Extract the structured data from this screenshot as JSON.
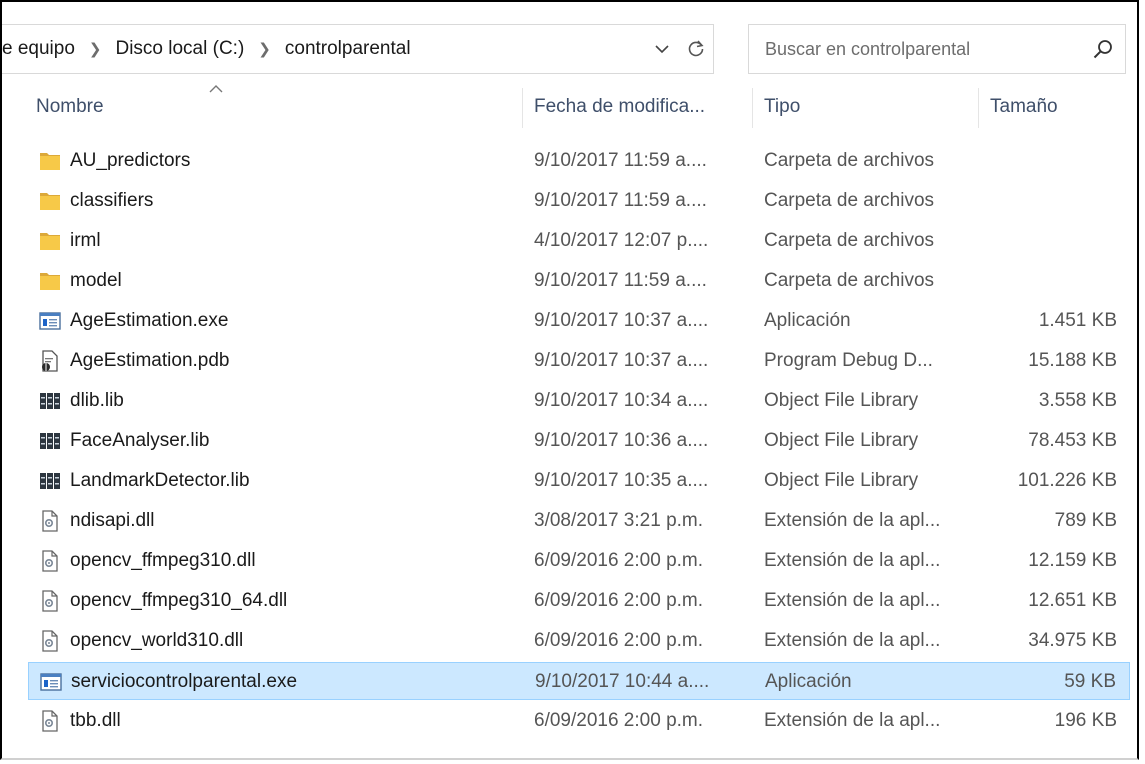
{
  "address": {
    "crumbs": [
      "e equipo",
      "Disco local (C:)",
      "controlparental"
    ],
    "chevron_icon": "chevron-right-icon",
    "dropdown_icon": "chevron-down-icon",
    "refresh_icon": "refresh-icon"
  },
  "search": {
    "placeholder": "Buscar en controlparental",
    "icon": "search-icon"
  },
  "columns": {
    "name": "Nombre",
    "date": "Fecha de modifica...",
    "type": "Tipo",
    "size": "Tamaño",
    "sorted_by": "name"
  },
  "colors": {
    "folder": "#f7c948",
    "selection_bg": "#cce8ff",
    "selection_border": "#99d1ff",
    "header_text": "#3f4f6a"
  },
  "files": [
    {
      "name": "AU_predictors",
      "date": "9/10/2017 11:59 a....",
      "type": "Carpeta de archivos",
      "size": "",
      "icon": "folder-icon"
    },
    {
      "name": "classifiers",
      "date": "9/10/2017 11:59 a....",
      "type": "Carpeta de archivos",
      "size": "",
      "icon": "folder-icon"
    },
    {
      "name": "irml",
      "date": "4/10/2017 12:07 p....",
      "type": "Carpeta de archivos",
      "size": "",
      "icon": "folder-icon"
    },
    {
      "name": "model",
      "date": "9/10/2017 11:59 a....",
      "type": "Carpeta de archivos",
      "size": "",
      "icon": "folder-icon"
    },
    {
      "name": "AgeEstimation.exe",
      "date": "9/10/2017 10:37 a....",
      "type": "Aplicación",
      "size": "1.451 KB",
      "icon": "application-icon"
    },
    {
      "name": "AgeEstimation.pdb",
      "date": "9/10/2017 10:37 a....",
      "type": "Program Debug D...",
      "size": "15.188 KB",
      "icon": "debug-file-icon"
    },
    {
      "name": "dlib.lib",
      "date": "9/10/2017 10:34 a....",
      "type": "Object File Library",
      "size": "3.558 KB",
      "icon": "library-icon"
    },
    {
      "name": "FaceAnalyser.lib",
      "date": "9/10/2017 10:36 a....",
      "type": "Object File Library",
      "size": "78.453 KB",
      "icon": "library-icon"
    },
    {
      "name": "LandmarkDetector.lib",
      "date": "9/10/2017 10:35 a....",
      "type": "Object File Library",
      "size": "101.226 KB",
      "icon": "library-icon"
    },
    {
      "name": "ndisapi.dll",
      "date": "3/08/2017 3:21 p.m.",
      "type": "Extensión de la apl...",
      "size": "789 KB",
      "icon": "dll-icon"
    },
    {
      "name": "opencv_ffmpeg310.dll",
      "date": "6/09/2016 2:00 p.m.",
      "type": "Extensión de la apl...",
      "size": "12.159 KB",
      "icon": "dll-icon"
    },
    {
      "name": "opencv_ffmpeg310_64.dll",
      "date": "6/09/2016 2:00 p.m.",
      "type": "Extensión de la apl...",
      "size": "12.651 KB",
      "icon": "dll-icon"
    },
    {
      "name": "opencv_world310.dll",
      "date": "6/09/2016 2:00 p.m.",
      "type": "Extensión de la apl...",
      "size": "34.975 KB",
      "icon": "dll-icon"
    },
    {
      "name": "serviciocontrolparental.exe",
      "date": "9/10/2017 10:44 a....",
      "type": "Aplicación",
      "size": "59 KB",
      "icon": "application-icon",
      "selected": true
    },
    {
      "name": "tbb.dll",
      "date": "6/09/2016 2:00 p.m.",
      "type": "Extensión de la apl...",
      "size": "196 KB",
      "icon": "dll-icon"
    }
  ]
}
